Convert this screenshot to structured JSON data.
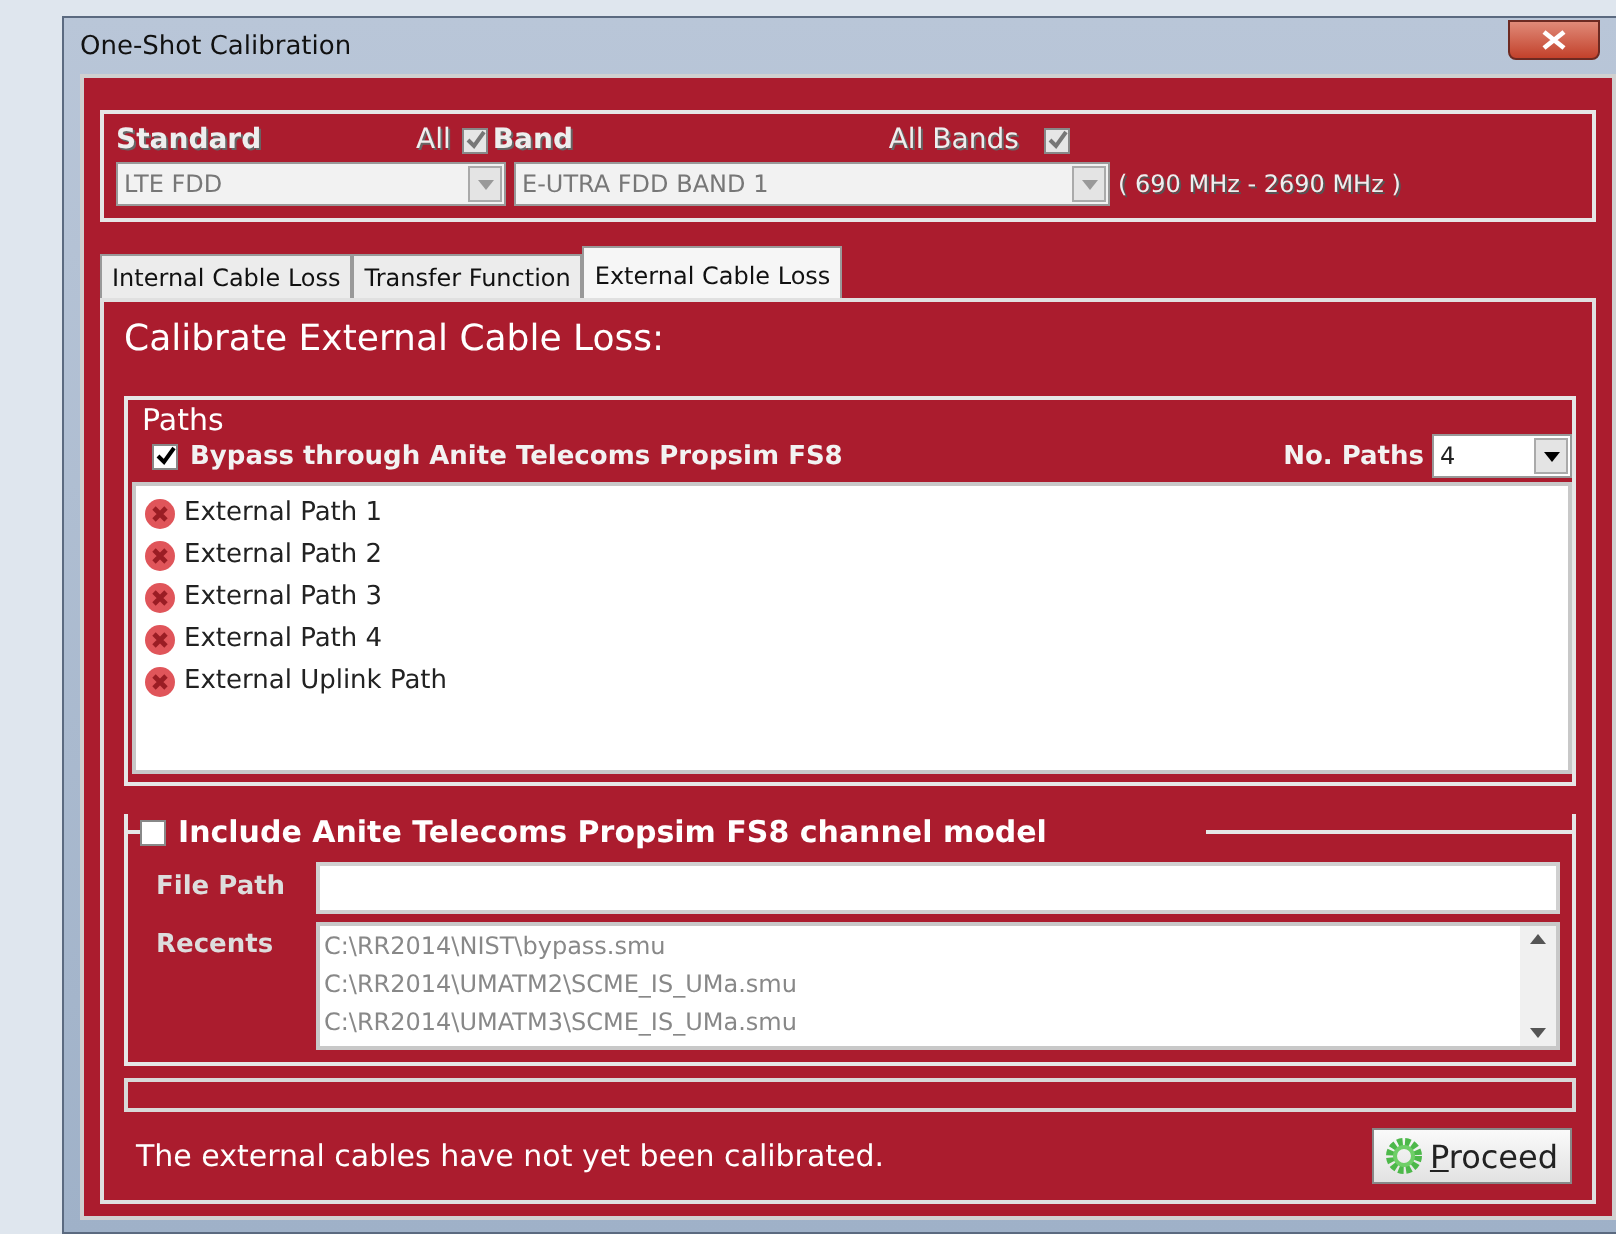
{
  "window": {
    "title": "One-Shot Calibration"
  },
  "selection": {
    "standard_label": "Standard",
    "all_standards": {
      "label": "All",
      "checked": true
    },
    "band_label": "Band",
    "all_bands": {
      "label": "All Bands",
      "checked": true
    },
    "standard_combo": {
      "value": "LTE FDD",
      "disabled": true
    },
    "band_combo": {
      "value": "E-UTRA FDD BAND 1",
      "disabled": true
    },
    "range": "( 690 MHz  - 2690 MHz )"
  },
  "tabs": [
    {
      "label": "Internal Cable Loss",
      "selected": false
    },
    {
      "label": "Transfer Function",
      "selected": false
    },
    {
      "label": "External Cable Loss",
      "selected": true
    }
  ],
  "heading": "Calibrate External Cable Loss:",
  "paths": {
    "legend": "Paths",
    "bypass": {
      "label": "Bypass through Anite Telecoms  Propsim FS8",
      "checked": true
    },
    "count_label": "No. Paths",
    "count": "4",
    "items": [
      {
        "label": "External Path 1",
        "calibrated": false
      },
      {
        "label": "External Path 2",
        "calibrated": false
      },
      {
        "label": "External Path 3",
        "calibrated": false
      },
      {
        "label": "External Path 4",
        "calibrated": false
      },
      {
        "label": "External Uplink Path",
        "calibrated": false
      }
    ]
  },
  "channel_model": {
    "label": "Include Anite Telecoms  Propsim FS8 channel model",
    "checked": false,
    "file_path_label": "File Path",
    "recents_label": "Recents",
    "recents": [
      "C:\\RR2014\\NIST\\bypass.smu",
      "C:\\RR2014\\UMATM2\\SCME_IS_UMa.smu",
      "C:\\RR2014\\UMATM3\\SCME_IS_UMa.smu"
    ]
  },
  "progress": {
    "level": 0
  },
  "status": "The external cables have not yet been calibrated.",
  "proceed_button": {
    "label": "Proceed"
  }
}
